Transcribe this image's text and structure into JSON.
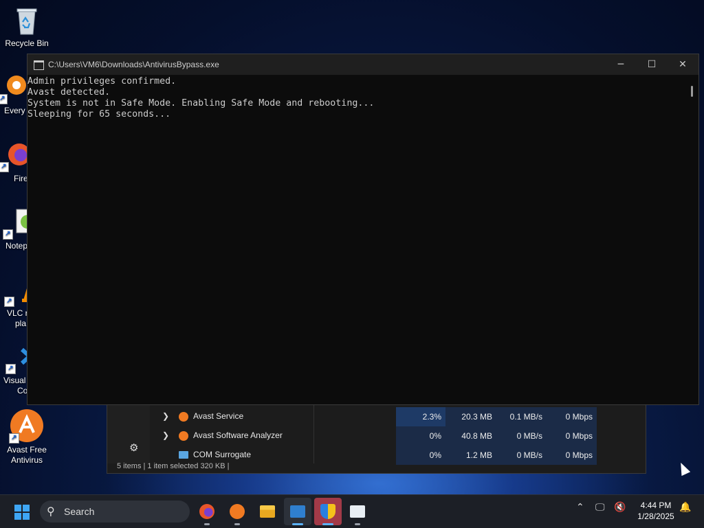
{
  "desktop": {
    "icons": [
      {
        "name": "recycle-bin",
        "label": "Recycle Bin"
      },
      {
        "name": "everything",
        "label": "Every"
      },
      {
        "name": "firefox",
        "label": "Fire"
      },
      {
        "name": "notepad",
        "label": "Notep"
      },
      {
        "name": "vlc",
        "label": "VLC r",
        "label2": "pla"
      },
      {
        "name": "vscode",
        "label": "Visual",
        "label2": "Co"
      },
      {
        "name": "avast",
        "label": "Avast Free",
        "label2": "Antivirus"
      }
    ]
  },
  "console": {
    "title": "C:\\Users\\VM6\\Downloads\\AntivirusBypass.exe",
    "lines": [
      "Admin privileges confirmed.",
      "Avast detected.",
      "System is not in Safe Mode. Enabling Safe Mode and rebooting...",
      "Sleeping for 65 seconds..."
    ],
    "buttons": {
      "minimize": "─",
      "maximize": "☐",
      "close": "✕"
    }
  },
  "task_manager": {
    "rows": [
      {
        "name": "Avast Service",
        "cpu": "2.3%",
        "memory": "20.3 MB",
        "disk": "0.1 MB/s",
        "network": "0 Mbps"
      },
      {
        "name": "Avast Software Analyzer",
        "cpu": "0%",
        "memory": "40.8 MB",
        "disk": "0 MB/s",
        "network": "0 Mbps"
      },
      {
        "name": "COM Surrogate",
        "cpu": "0%",
        "memory": "1.2 MB",
        "disk": "0 MB/s",
        "network": "0 Mbps"
      }
    ],
    "status": "5 items  |  1 item selected  320 KB  |"
  },
  "taskbar": {
    "search_placeholder": "Search",
    "apps": [
      "firefox",
      "avast",
      "file-explorer",
      "terminal",
      "windows-security",
      "notepad"
    ],
    "time": "4:44 PM",
    "date": "1/28/2025"
  }
}
